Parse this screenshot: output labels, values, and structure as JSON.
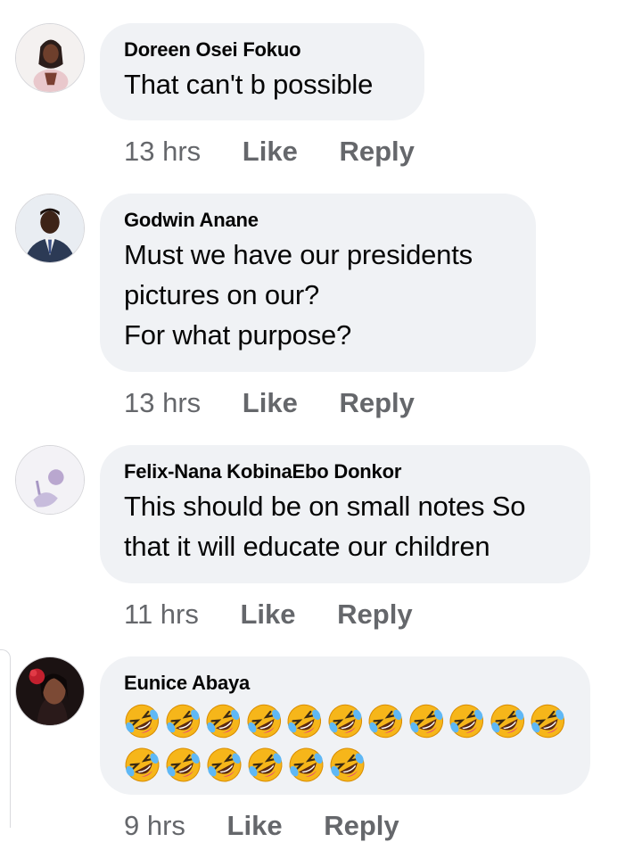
{
  "comments": [
    {
      "author": "Doreen Osei Fokuo",
      "text": "That can't b possible",
      "time": "13 hrs",
      "like_label": "Like",
      "reply_label": "Reply"
    },
    {
      "author": "Godwin Anane",
      "text": "Must we have our presidents\npictures on our?\nFor what purpose?",
      "time": "13 hrs",
      "like_label": "Like",
      "reply_label": "Reply"
    },
    {
      "author": "Felix-Nana KobinaEbo Donkor",
      "text": "This should be on small notes So\nthat it will educate our children",
      "time": "11 hrs",
      "like_label": "Like",
      "reply_label": "Reply"
    },
    {
      "author": "Eunice Abaya",
      "emoji_icon": "rolling-on-floor-laughing-icon",
      "emoji_count_row1": 11,
      "emoji_count_row2": 6,
      "time": "9 hrs",
      "like_label": "Like",
      "reply_label": "Reply"
    }
  ],
  "colors": {
    "bubble_bg": "#f0f2f5",
    "meta_text": "#65676b",
    "primary_text": "#050505"
  }
}
